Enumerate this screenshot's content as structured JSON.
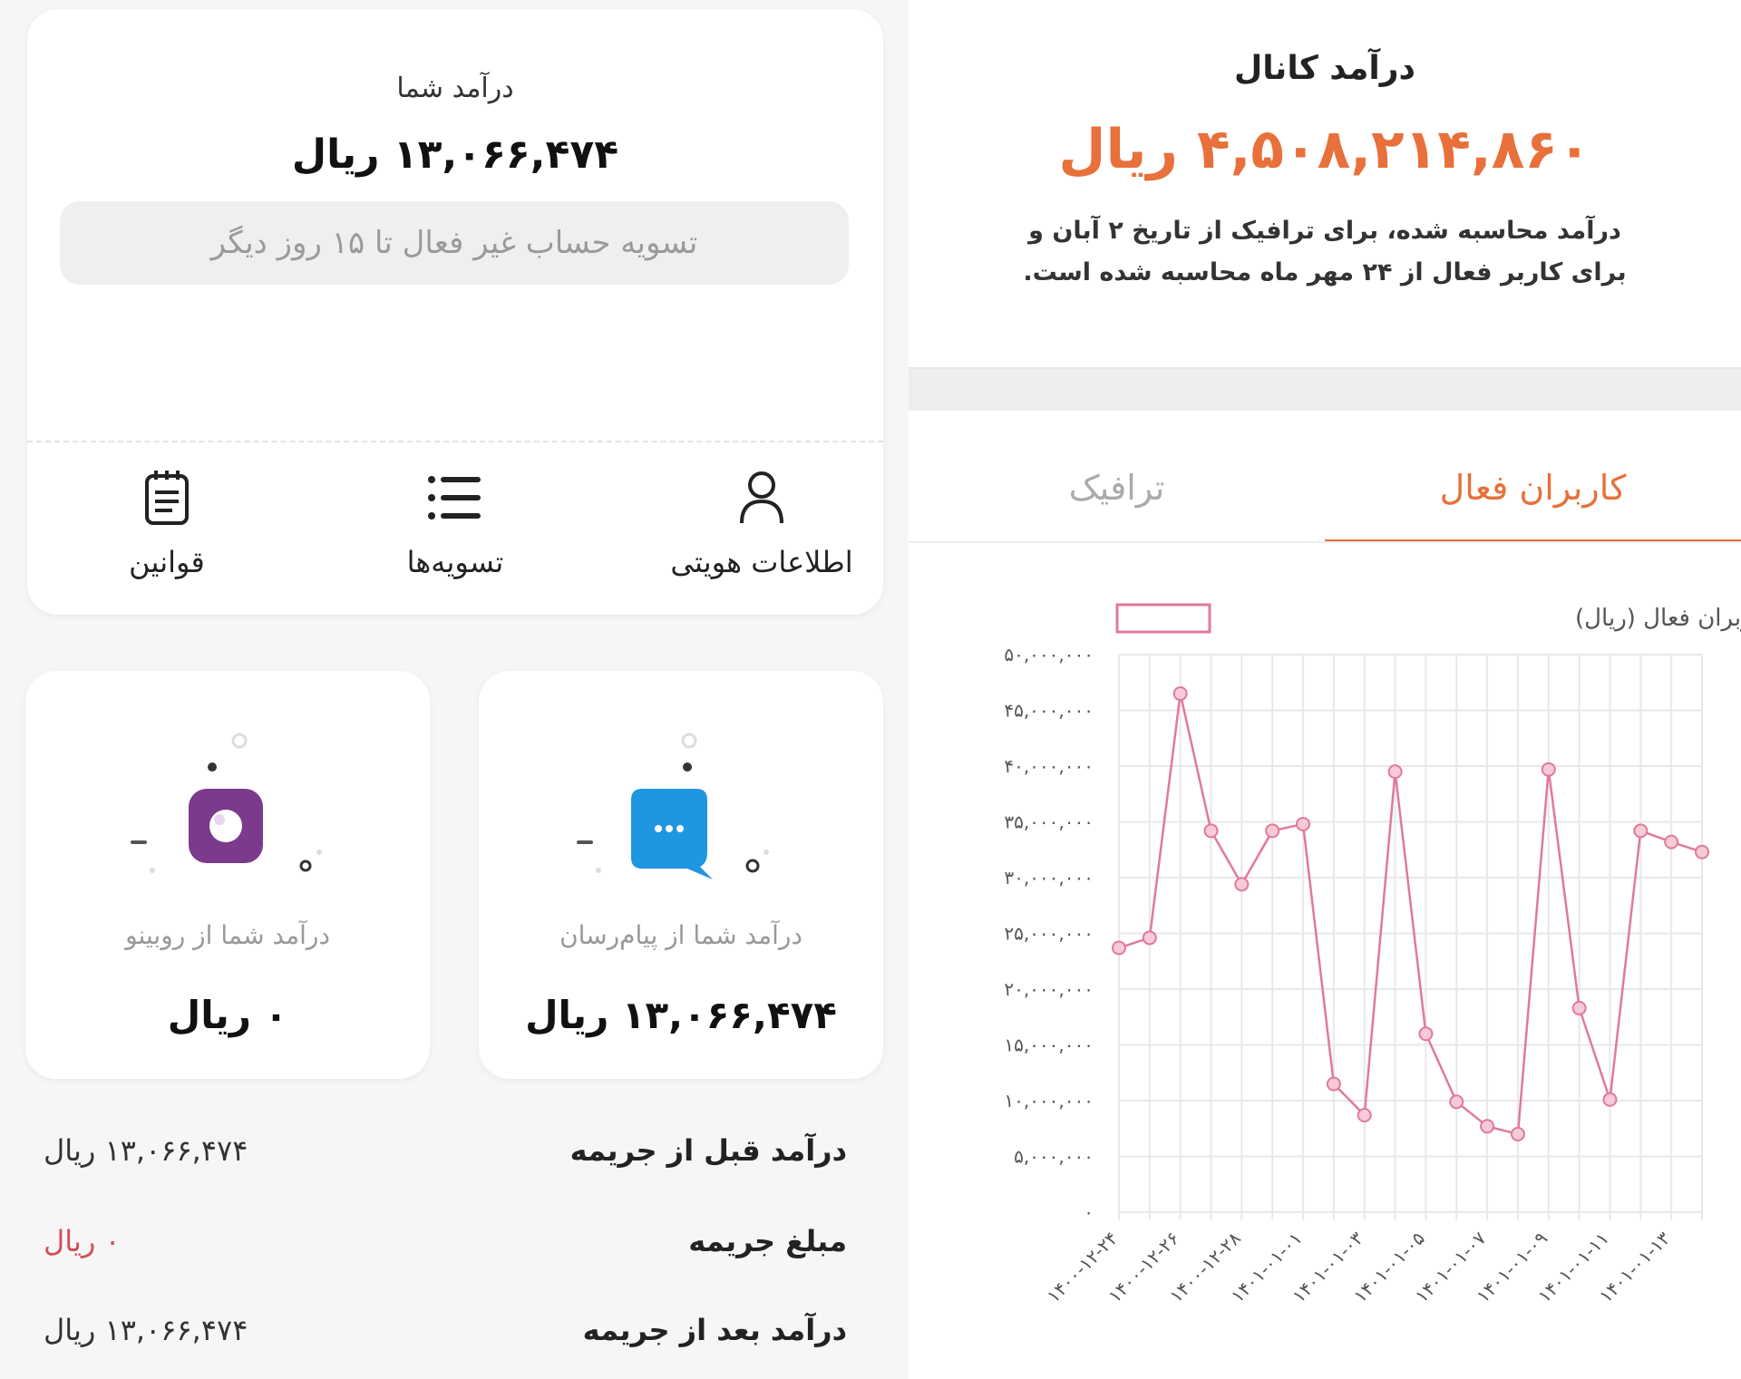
{
  "left": {
    "income_card": {
      "label": "درآمد شما",
      "amount": "۱۳,۰۶۶,۴۷۴ ریال",
      "settlement_note": "تسویه حساب غیر فعال تا ۱۵ روز دیگر",
      "actions": [
        {
          "label": "اطلاعات هویتی",
          "icon": "user-icon"
        },
        {
          "label": "تسویه‌ها",
          "icon": "list-icon"
        },
        {
          "label": "قوانین",
          "icon": "notepad-icon"
        }
      ]
    },
    "messenger_cards": [
      {
        "caption": "درآمد شما از پیام‌رسان",
        "amount": "۱۳,۰۶۶,۴۷۴ ریال",
        "icon": "chat-bubble-icon",
        "color": "#1e96e0"
      },
      {
        "caption": "درآمد شما از روبینو",
        "amount": "۰ ریال",
        "icon": "rubino-icon",
        "color": "#7b3a8c"
      }
    ],
    "summary": [
      {
        "key": "درآمد قبل از جریمه",
        "value": "۱۳,۰۶۶,۴۷۴ ریال"
      },
      {
        "key": "مبلغ جریمه",
        "value": "۰ ریال",
        "color": "#d0505a"
      },
      {
        "key": "درآمد بعد از جریمه",
        "value": "۱۳,۰۶۶,۴۷۴ ریال"
      }
    ]
  },
  "right": {
    "title": "درآمد کانال",
    "amount": "۴,۵۰۸,۲۱۴,۸۶۰ ریال",
    "accent": "#e8703a",
    "note_line1": "درآمد محاسبه شده، برای ترافیک از تاریخ ۲ آبان و",
    "note_line2": "برای کاربر فعال از ۲۴ مهر ماه محاسبه شده است.",
    "tabs": {
      "active": "کاربران فعال",
      "other": "ترافیک"
    }
  },
  "chart_data": {
    "type": "line",
    "legend": "درآمد روزانه کاربران فعال (ریال)",
    "legend_position": "top",
    "grid": true,
    "color": "#e07a98",
    "ylim": [
      0,
      50000000
    ],
    "y_ticks": [
      0,
      5000000,
      10000000,
      15000000,
      20000000,
      25000000,
      30000000,
      35000000,
      40000000,
      45000000,
      50000000
    ],
    "y_tick_labels": [
      "۰",
      "۵,۰۰۰,۰۰۰",
      "۱۰,۰۰۰,۰۰۰",
      "۱۵,۰۰۰,۰۰۰",
      "۲۰,۰۰۰,۰۰۰",
      "۲۵,۰۰۰,۰۰۰",
      "۳۰,۰۰۰,۰۰۰",
      "۳۵,۰۰۰,۰۰۰",
      "۴۰,۰۰۰,۰۰۰",
      "۴۵,۰۰۰,۰۰۰",
      "۵۰,۰۰۰,۰۰۰"
    ],
    "x_labels": [
      "۱۴۰۰-۱۲-۲۴",
      "۱۴۰۰-۱۲-۲۶",
      "۱۴۰۰-۱۲-۲۸",
      "۱۴۰۱-۰۱-۰۱",
      "۱۴۰۱-۰۱-۰۳",
      "۱۴۰۱-۰۱-۰۵",
      "۱۴۰۱-۰۱-۰۷",
      "۱۴۰۱-۰۱-۰۹",
      "۱۴۰۱-۰۱-۱۱",
      "۱۴۰۱-۰۱-۱۳"
    ],
    "values": [
      23700000,
      24600000,
      46500000,
      34200000,
      29400000,
      34200000,
      34800000,
      11500000,
      8700000,
      39500000,
      16000000,
      9900000,
      7700000,
      7000000,
      39700000,
      18300000,
      10100000,
      34200000,
      33200000,
      32300000
    ]
  }
}
